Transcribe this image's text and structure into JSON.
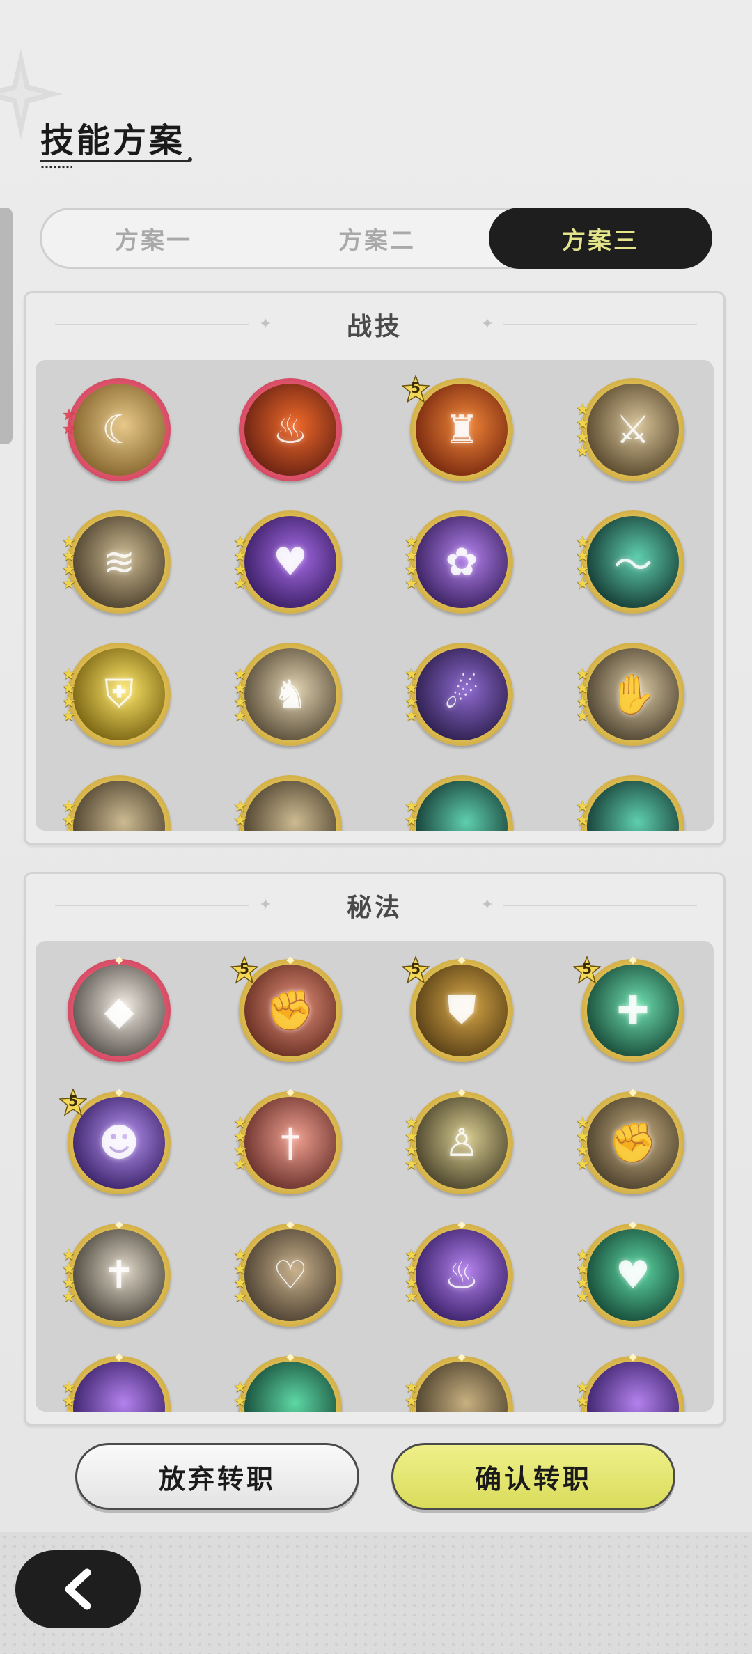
{
  "page": {
    "title": "技能方案"
  },
  "tabs": [
    {
      "label": "方案一",
      "active": false
    },
    {
      "label": "方案二",
      "active": false
    },
    {
      "label": "方案三",
      "active": true
    }
  ],
  "sections": [
    {
      "title": "战技",
      "skills": [
        {
          "icon": "sweep-slash-icon",
          "colors": [
            "#7a5a22",
            "#e8c98a"
          ],
          "frame": "red",
          "stars": 2,
          "badge": ""
        },
        {
          "icon": "fire-swirl-icon",
          "colors": [
            "#5a1a10",
            "#f06a2a"
          ],
          "frame": "red",
          "stars": 0,
          "badge": ""
        },
        {
          "icon": "flame-emblem-icon",
          "colors": [
            "#6a1e0a",
            "#f4883a"
          ],
          "frame": "gold",
          "stars": 0,
          "badge": "5"
        },
        {
          "icon": "sword-strike-icon",
          "colors": [
            "#4a3a20",
            "#d8c49a"
          ],
          "frame": "gold",
          "stars": 4,
          "badge": ""
        },
        {
          "icon": "wind-slash-icon",
          "colors": [
            "#3e3322",
            "#cdbb92"
          ],
          "frame": "gold",
          "stars": 4,
          "badge": ""
        },
        {
          "icon": "arcane-heart-icon",
          "colors": [
            "#2e1656",
            "#a66be6"
          ],
          "frame": "gold",
          "stars": 4,
          "badge": ""
        },
        {
          "icon": "rose-burst-icon",
          "colors": [
            "#2c1650",
            "#b482ee"
          ],
          "frame": "gold",
          "stars": 4,
          "badge": ""
        },
        {
          "icon": "jade-wave-icon",
          "colors": [
            "#0d2a26",
            "#5fcfae"
          ],
          "frame": "gold",
          "stars": 4,
          "badge": ""
        },
        {
          "icon": "golden-shield-icon",
          "colors": [
            "#6a5408",
            "#ffe86a"
          ],
          "frame": "gold",
          "stars": 4,
          "badge": ""
        },
        {
          "icon": "beast-charge-icon",
          "colors": [
            "#4a3e2c",
            "#e0d2b0"
          ],
          "frame": "gold",
          "stars": 4,
          "badge": ""
        },
        {
          "icon": "shadow-claw-icon",
          "colors": [
            "#22163e",
            "#8e6ad0"
          ],
          "frame": "gold",
          "stars": 4,
          "badge": ""
        },
        {
          "icon": "grasping-hand-icon",
          "colors": [
            "#3e3424",
            "#d9c8a2"
          ],
          "frame": "gold",
          "stars": 4,
          "badge": ""
        },
        {
          "icon": "partial-skill-icon",
          "colors": [
            "#3e3322",
            "#cdbb92"
          ],
          "frame": "gold",
          "stars": 4,
          "badge": ""
        },
        {
          "icon": "partial-skill-icon",
          "colors": [
            "#3e3322",
            "#cdbb92"
          ],
          "frame": "gold",
          "stars": 4,
          "badge": ""
        },
        {
          "icon": "partial-skill-icon",
          "colors": [
            "#0d2a26",
            "#5fcfae"
          ],
          "frame": "gold",
          "stars": 4,
          "badge": ""
        },
        {
          "icon": "partial-skill-icon",
          "colors": [
            "#0d2a26",
            "#5fcfae"
          ],
          "frame": "gold",
          "stars": 4,
          "badge": ""
        }
      ]
    },
    {
      "title": "秘法",
      "skills": [
        {
          "icon": "blade-orb-icon",
          "colors": [
            "#4a4440",
            "#f2ece2"
          ],
          "frame": "red",
          "stars": 0,
          "badge": ""
        },
        {
          "icon": "crimson-fist-icon",
          "colors": [
            "#5a2418",
            "#e4907a"
          ],
          "frame": "gold",
          "stars": 0,
          "badge": "5"
        },
        {
          "icon": "golden-armor-icon",
          "colors": [
            "#4a3410",
            "#d8a848"
          ],
          "frame": "gold",
          "stars": 0,
          "badge": "5"
        },
        {
          "icon": "healing-plus-icon",
          "colors": [
            "#0e3a2c",
            "#6fe0b0"
          ],
          "frame": "gold",
          "stars": 0,
          "badge": "5"
        },
        {
          "icon": "purple-silhouette-icon",
          "colors": [
            "#2c165a",
            "#b894f2"
          ],
          "frame": "gold",
          "stars": 0,
          "badge": "5"
        },
        {
          "icon": "red-sword-icon",
          "colors": [
            "#5a2420",
            "#f0a090"
          ],
          "frame": "gold",
          "stars": 4,
          "badge": ""
        },
        {
          "icon": "golem-icon",
          "colors": [
            "#3a3420",
            "#d8cc90"
          ],
          "frame": "gold",
          "stars": 4,
          "badge": ""
        },
        {
          "icon": "power-fist-icon",
          "colors": [
            "#3e3424",
            "#c8b080"
          ],
          "frame": "gold",
          "stars": 4,
          "badge": ""
        },
        {
          "icon": "sword-emblem-icon",
          "colors": [
            "#3a342c",
            "#e0d8c8"
          ],
          "frame": "gold",
          "stars": 4,
          "badge": ""
        },
        {
          "icon": "heart-shield-icon",
          "colors": [
            "#3e3428",
            "#c8b08a"
          ],
          "frame": "gold",
          "stars": 4,
          "badge": ""
        },
        {
          "icon": "violet-flame-icon",
          "colors": [
            "#2c165a",
            "#b482ee"
          ],
          "frame": "gold",
          "stars": 4,
          "badge": ""
        },
        {
          "icon": "green-heart-icon",
          "colors": [
            "#0e3a2c",
            "#5ed8a4"
          ],
          "frame": "gold",
          "stars": 4,
          "badge": ""
        },
        {
          "icon": "partial-skill-icon",
          "colors": [
            "#2c165a",
            "#b482ee"
          ],
          "frame": "gold",
          "stars": 4,
          "badge": ""
        },
        {
          "icon": "partial-skill-icon",
          "colors": [
            "#0e3a2c",
            "#5ed8a4"
          ],
          "frame": "gold",
          "stars": 4,
          "badge": ""
        },
        {
          "icon": "partial-skill-icon",
          "colors": [
            "#3e3424",
            "#c8b080"
          ],
          "frame": "gold",
          "stars": 4,
          "badge": ""
        },
        {
          "icon": "partial-skill-icon",
          "colors": [
            "#2c165a",
            "#b482ee"
          ],
          "frame": "gold",
          "stars": 4,
          "badge": ""
        }
      ]
    }
  ],
  "buttons": {
    "abandon": "放弃转职",
    "confirm": "确认转职"
  },
  "nav": {
    "back_icon": "chevron-left-icon"
  },
  "theme": {
    "tab_active_bg": "#1e1e1e",
    "tab_active_text": "#e4e48a",
    "confirm_bg": "#dadc5c",
    "gold_frame": "#e5c55a",
    "red_frame": "#e2566e"
  }
}
